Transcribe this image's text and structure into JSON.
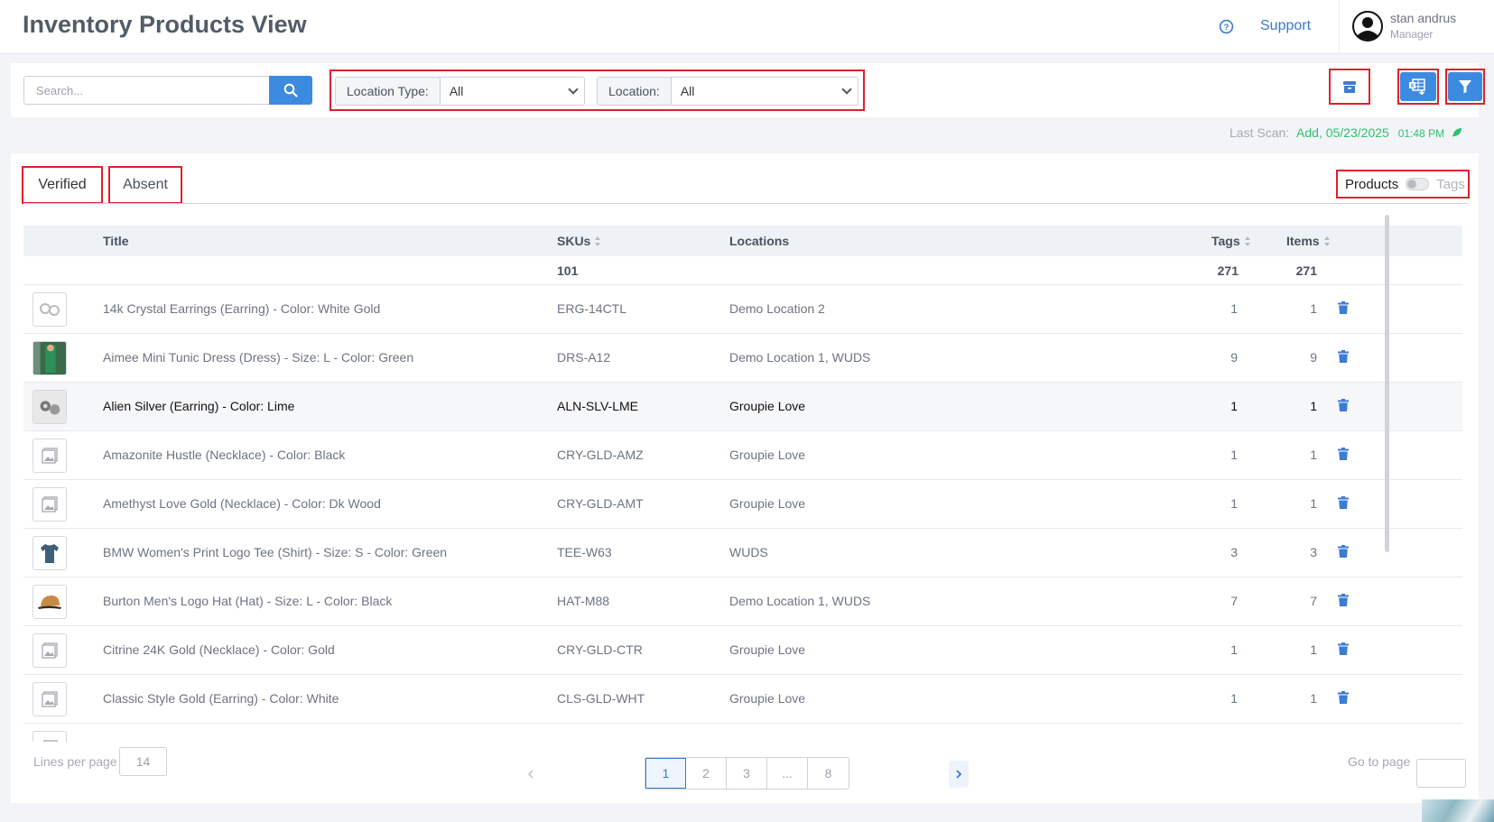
{
  "header": {
    "title": "Inventory Products View",
    "support_label": "Support",
    "user_name": "stan andrus",
    "user_role": "Manager"
  },
  "toolbar": {
    "search_placeholder": "Search...",
    "location_type_label": "Location Type:",
    "location_type_value": "All",
    "location_label": "Location:",
    "location_value": "All"
  },
  "last_scan": {
    "label": "Last Scan:",
    "value": "Add, 05/23/2025",
    "time": "01:48 PM"
  },
  "tabs": {
    "verified": "Verified",
    "absent": "Absent"
  },
  "view_toggle": {
    "left": "Products",
    "right": "Tags"
  },
  "table": {
    "headers": {
      "title": "Title",
      "skus": "SKUs",
      "locations": "Locations",
      "tags": "Tags",
      "items": "Items"
    },
    "totals": {
      "skus": "101",
      "tags": "271",
      "items": "271"
    },
    "rows": [
      {
        "thumb": "earrings",
        "title": "14k Crystal Earrings (Earring) - Color: White Gold",
        "sku": "ERG-14CTL",
        "location": "Demo Location 2",
        "tags": "1",
        "items": "1"
      },
      {
        "thumb": "dress",
        "title": "Aimee Mini Tunic Dress (Dress) - Size: L - Color: Green",
        "sku": "DRS-A12",
        "location": "Demo Location 1, WUDS",
        "tags": "9",
        "items": "9"
      },
      {
        "thumb": "silver-earring",
        "title": "Alien Silver (Earring) - Color: Lime",
        "sku": "ALN-SLV-LME",
        "location": "Groupie Love",
        "tags": "1",
        "items": "1"
      },
      {
        "thumb": "placeholder",
        "title": "Amazonite Hustle (Necklace) - Color: Black",
        "sku": "CRY-GLD-AMZ",
        "location": "Groupie Love",
        "tags": "1",
        "items": "1"
      },
      {
        "thumb": "placeholder",
        "title": "Amethyst Love Gold (Necklace) - Color: Dk Wood",
        "sku": "CRY-GLD-AMT",
        "location": "Groupie Love",
        "tags": "1",
        "items": "1"
      },
      {
        "thumb": "tee",
        "title": "BMW Women's Print Logo Tee (Shirt) - Size: S - Color: Green",
        "sku": "TEE-W63",
        "location": "WUDS",
        "tags": "3",
        "items": "3"
      },
      {
        "thumb": "hat",
        "title": "Burton Men's Logo Hat (Hat) - Size: L - Color: Black",
        "sku": "HAT-M88",
        "location": "Demo Location 1, WUDS",
        "tags": "7",
        "items": "7"
      },
      {
        "thumb": "placeholder",
        "title": "Citrine 24K Gold (Necklace) - Color: Gold",
        "sku": "CRY-GLD-CTR",
        "location": "Groupie Love",
        "tags": "1",
        "items": "1"
      },
      {
        "thumb": "placeholder",
        "title": "Classic Style Gold (Earring) - Color: White",
        "sku": "CLS-GLD-WHT",
        "location": "Groupie Love",
        "tags": "1",
        "items": "1"
      }
    ]
  },
  "pagination": {
    "lines_label": "Lines per page",
    "lines_value": "14",
    "pages": [
      "1",
      "2",
      "3",
      "...",
      "8"
    ],
    "current": "1",
    "goto_label": "Go to page"
  },
  "colors": {
    "accent": "#3d8be0",
    "highlight_border": "#e0202c",
    "scan_green": "#2fbf71"
  }
}
